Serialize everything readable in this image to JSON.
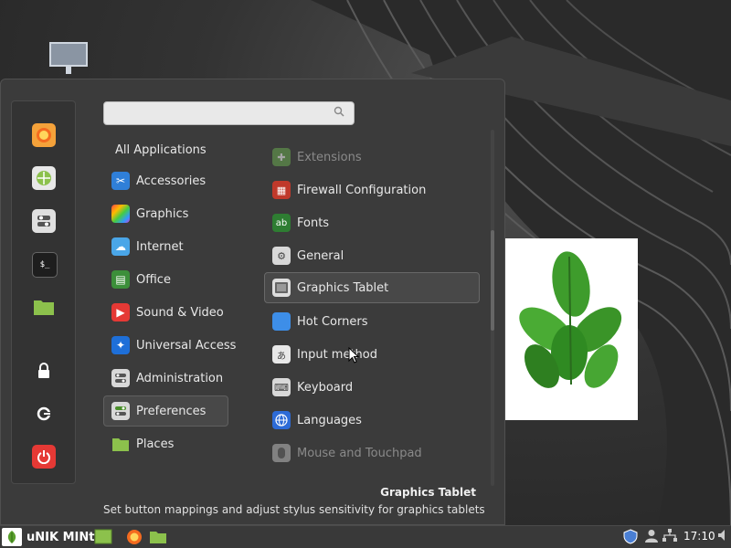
{
  "search": {
    "placeholder": "",
    "value": ""
  },
  "favorites": [
    {
      "name": "firefox-icon",
      "color": "#f7a23a"
    },
    {
      "name": "software-manager-icon",
      "color": "#8cc14c"
    },
    {
      "name": "system-settings-icon",
      "color": "#e0e0e0"
    },
    {
      "name": "terminal-icon",
      "color": "#1e1e1e",
      "glyph": "$_"
    },
    {
      "name": "folder-icon",
      "color": "#8cc14c"
    },
    {
      "name": "lock-screen-icon",
      "glyph": "🔒"
    },
    {
      "name": "logout-icon",
      "glyph": "⟳"
    },
    {
      "name": "power-icon",
      "color": "#e53935",
      "glyph": "⏻"
    }
  ],
  "categories": [
    {
      "label": "All Applications"
    },
    {
      "label": "Accessories",
      "icon": "accessories-icon",
      "color": "#2f7fd8",
      "glyph": "✂"
    },
    {
      "label": "Graphics",
      "icon": "graphics-icon",
      "color": "#c44bd0",
      "glyph": ""
    },
    {
      "label": "Internet",
      "icon": "internet-icon",
      "color": "#4aa6e8",
      "glyph": "☁"
    },
    {
      "label": "Office",
      "icon": "office-icon",
      "color": "#3c8f3a",
      "glyph": "▤"
    },
    {
      "label": "Sound & Video",
      "icon": "sound-video-icon",
      "color": "#e53935",
      "glyph": "▶"
    },
    {
      "label": "Universal Access",
      "icon": "universal-access-icon",
      "color": "#1e6fd8",
      "glyph": "✦"
    },
    {
      "label": "Administration",
      "icon": "administration-icon",
      "color": "#d8d8d8",
      "glyph": ""
    },
    {
      "label": "Preferences",
      "icon": "preferences-icon",
      "color": "#d8d8d8",
      "glyph": ""
    },
    {
      "label": "Places",
      "icon": "places-icon",
      "color": "#8cc14c",
      "glyph": ""
    }
  ],
  "apps": [
    {
      "label": "Extensions",
      "icon": "extensions-icon",
      "color": "#6aa84f",
      "glyph": "✚",
      "dim": true
    },
    {
      "label": "Firewall Configuration",
      "icon": "firewall-icon",
      "color": "#c0392b",
      "glyph": "▦"
    },
    {
      "label": "Fonts",
      "icon": "fonts-icon",
      "color": "#2e7d32",
      "glyph": "ab"
    },
    {
      "label": "General",
      "icon": "general-icon",
      "color": "#d8d8d8",
      "glyph": "⚙"
    },
    {
      "label": "Graphics Tablet",
      "icon": "graphics-tablet-icon",
      "color": "#dddddd",
      "glyph": "▭"
    },
    {
      "label": "Hot Corners",
      "icon": "hot-corners-icon",
      "color": "#3d8ee8",
      "glyph": ""
    },
    {
      "label": "Input method",
      "icon": "input-method-icon",
      "color": "#e8e8e8",
      "glyph": "あ"
    },
    {
      "label": "Keyboard",
      "icon": "keyboard-icon",
      "color": "#d8d8d8",
      "glyph": "⌨"
    },
    {
      "label": "Languages",
      "icon": "languages-icon",
      "color": "#2d6bd6",
      "glyph": "🌐"
    },
    {
      "label": "Mouse and Touchpad",
      "icon": "mouse-icon",
      "color": "#bbbbbb",
      "glyph": "🖱",
      "dim": true
    }
  ],
  "selected": {
    "title": "Graphics Tablet",
    "description": "Set button mappings and adjust stylus sensitivity for graphics tablets"
  },
  "panel": {
    "menu_label": "uNIK MINt",
    "clock": "17:10"
  }
}
